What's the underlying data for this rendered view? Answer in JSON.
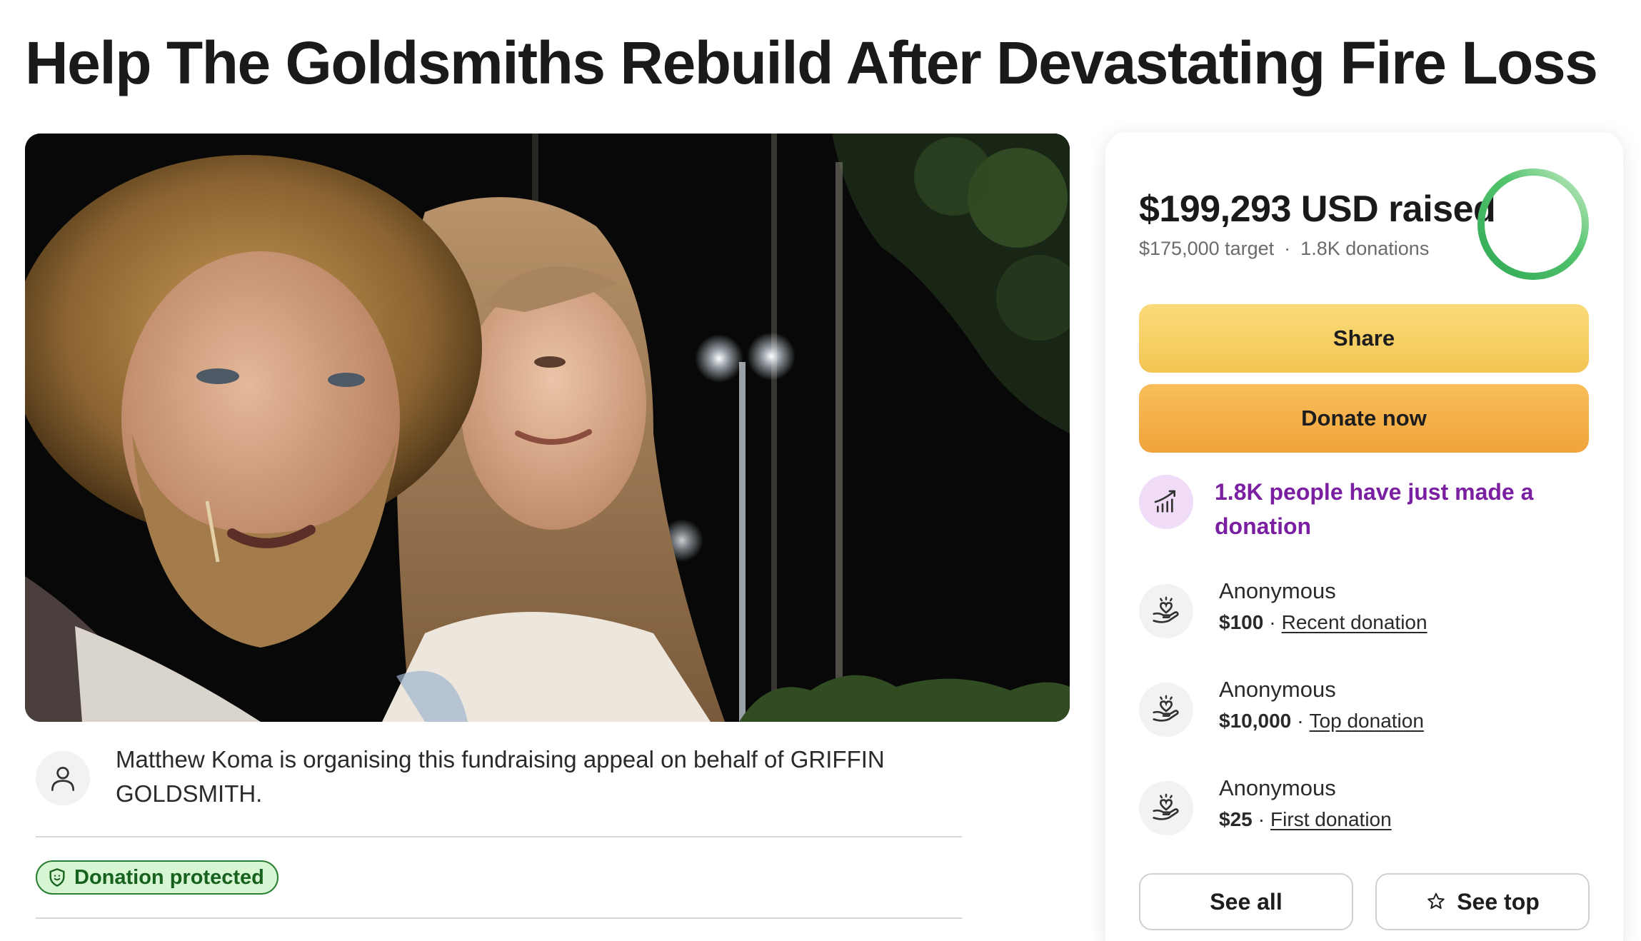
{
  "page": {
    "title": "Help The Goldsmiths Rebuild After Devastating Fire Loss"
  },
  "organiser": {
    "text": "Matthew Koma is organising this fundraising appeal on behalf of GRIFFIN GOLDSMITH.",
    "icon": "user-icon"
  },
  "badge": {
    "label": "Donation protected",
    "icon": "shield-icon"
  },
  "stats": {
    "raised": "$199,293 USD raised",
    "target": "$175,000 target",
    "separator": "·",
    "donations": "1.8K donations",
    "progress_fraction": 1.0,
    "progress_color": "#3fb760"
  },
  "actions": {
    "share_label": "Share",
    "donate_label": "Donate now"
  },
  "activity": {
    "text": "1.8K people have just made a donation",
    "icon": "trending-up-icon",
    "color": "#7b1fa2"
  },
  "donors": [
    {
      "name": "Anonymous",
      "amount": "$100",
      "sep": "·",
      "type": "Recent donation"
    },
    {
      "name": "Anonymous",
      "amount": "$10,000",
      "sep": "·",
      "type": "Top donation"
    },
    {
      "name": "Anonymous",
      "amount": "$25",
      "sep": "·",
      "type": "First donation"
    }
  ],
  "footer_buttons": {
    "see_all_label": "See all",
    "see_top_label": "See top",
    "see_top_icon": "star-icon"
  }
}
